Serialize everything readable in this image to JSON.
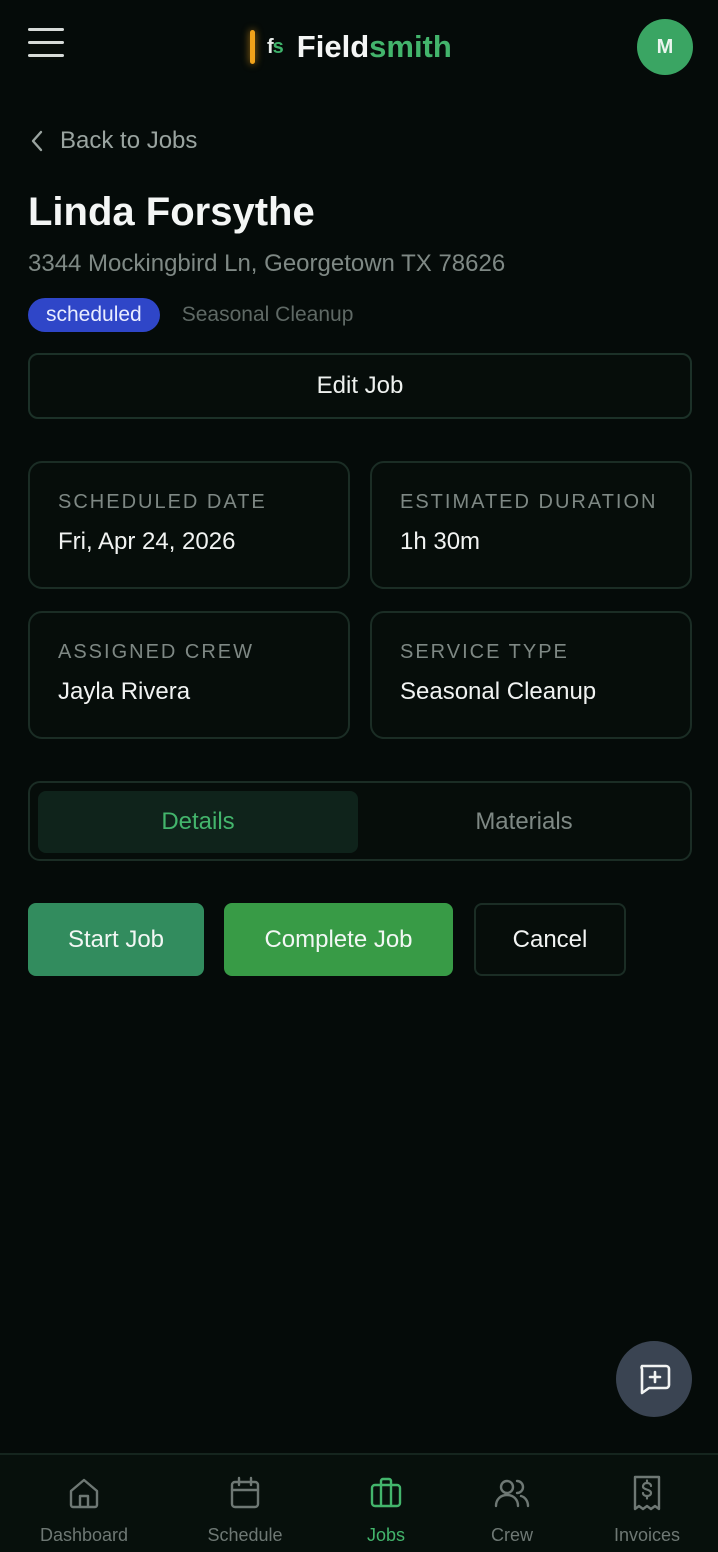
{
  "header": {
    "brand_mark_f": "f",
    "brand_mark_s": "s",
    "brand_name_a": "Field",
    "brand_name_b": "smith",
    "avatar_initial": "M",
    "menu_icon": "hamburger-icon"
  },
  "back": {
    "label": "Back to Jobs",
    "icon": "chevron-left-icon"
  },
  "job": {
    "customer": "Linda Forsythe",
    "address": "3344 Mockingbird Ln, Georgetown TX 78626",
    "status": "scheduled",
    "service_tag": "Seasonal Cleanup",
    "edit_label": "Edit Job"
  },
  "info_cards": [
    {
      "label": "SCHEDULED DATE",
      "value": "Fri, Apr 24, 2026"
    },
    {
      "label": "ESTIMATED DURATION",
      "value": "1h 30m"
    },
    {
      "label": "ASSIGNED CREW",
      "value": "Jayla Rivera"
    },
    {
      "label": "SERVICE TYPE",
      "value": "Seasonal Cleanup"
    }
  ],
  "tabs": [
    {
      "label": "Details",
      "active": true
    },
    {
      "label": "Materials",
      "active": false
    }
  ],
  "actions": {
    "start": "Start Job",
    "complete": "Complete Job",
    "cancel": "Cancel"
  },
  "fab": {
    "icon": "message-plus-icon"
  },
  "bottom_nav": [
    {
      "label": "Dashboard",
      "icon": "home-icon",
      "active": false
    },
    {
      "label": "Schedule",
      "icon": "calendar-icon",
      "active": false
    },
    {
      "label": "Jobs",
      "icon": "briefcase-icon",
      "active": true
    },
    {
      "label": "Crew",
      "icon": "users-icon",
      "active": false
    },
    {
      "label": "Invoices",
      "icon": "invoice-icon",
      "active": false
    }
  ],
  "colors": {
    "background": "#050b09",
    "accent_green": "#43b56c",
    "status_badge": "#2f46c8",
    "brand_bar": "#f0a21a"
  }
}
